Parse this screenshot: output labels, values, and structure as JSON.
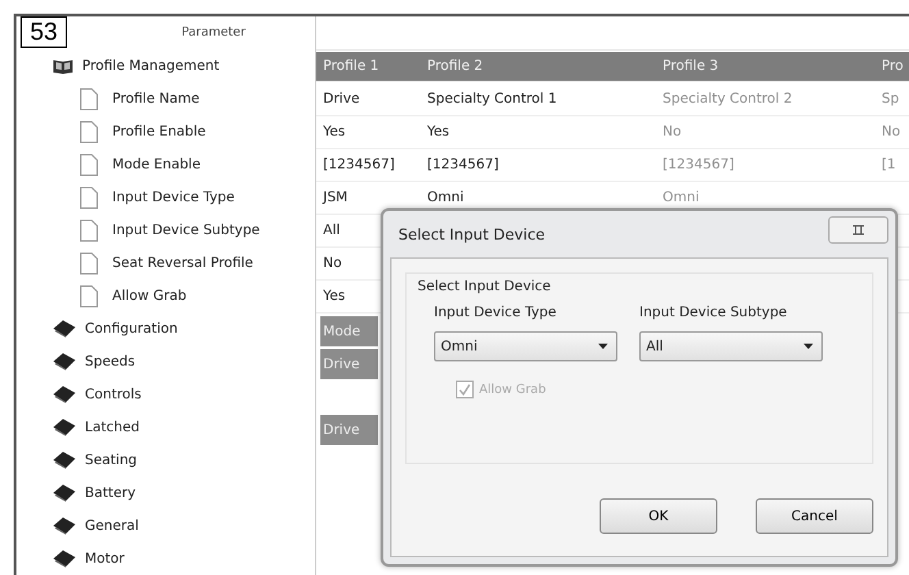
{
  "figure_label": "53",
  "tree": {
    "heading": "Parameter",
    "items": [
      {
        "label": "Profile Management",
        "expanded": true,
        "children": [
          {
            "label": "Profile Name"
          },
          {
            "label": "Profile Enable"
          },
          {
            "label": "Mode Enable"
          },
          {
            "label": "Input Device Type"
          },
          {
            "label": "Input Device Subtype"
          },
          {
            "label": "Seat Reversal Profile"
          },
          {
            "label": "Allow Grab"
          }
        ]
      },
      {
        "label": "Configuration",
        "expanded": false
      },
      {
        "label": "Speeds",
        "expanded": false
      },
      {
        "label": "Controls",
        "expanded": false
      },
      {
        "label": "Latched",
        "expanded": false
      },
      {
        "label": "Seating",
        "expanded": false
      },
      {
        "label": "Battery",
        "expanded": false
      },
      {
        "label": "General",
        "expanded": false
      },
      {
        "label": "Motor",
        "expanded": false
      }
    ]
  },
  "grid": {
    "columns": [
      {
        "header": "Profile 1",
        "dimmed": false
      },
      {
        "header": "Profile 2",
        "dimmed": false
      },
      {
        "header": "Profile 3",
        "dimmed": true
      },
      {
        "header": "Pro",
        "dimmed": true
      }
    ],
    "rows": [
      {
        "kind": "value",
        "cells": [
          "Drive",
          "Specialty Control 1",
          "Specialty Control 2",
          "Sp"
        ]
      },
      {
        "kind": "value",
        "cells": [
          "Yes",
          "Yes",
          "No",
          "No"
        ]
      },
      {
        "kind": "value",
        "cells": [
          "[1234567]",
          "[1234567]",
          "[1234567]",
          "[1"
        ]
      },
      {
        "kind": "value",
        "cells": [
          "JSM",
          "Omni",
          "Omni"
        ]
      },
      {
        "kind": "value",
        "cells": [
          "All"
        ]
      },
      {
        "kind": "value",
        "cells": [
          "No"
        ]
      },
      {
        "kind": "value",
        "cells": [
          "Yes"
        ]
      },
      {
        "kind": "section",
        "cells": [
          "Mode"
        ]
      },
      {
        "kind": "section",
        "cells": [
          "Drive"
        ]
      },
      {
        "kind": "blank",
        "cells": []
      },
      {
        "kind": "section",
        "cells": [
          "Drive"
        ]
      }
    ]
  },
  "dialog": {
    "title": "Select Input Device",
    "group_title": "Select Input Device",
    "fields": [
      {
        "label": "Input Device Type",
        "value": "Omni"
      },
      {
        "label": "Input Device Subtype",
        "value": "All"
      }
    ],
    "checkbox": {
      "label": "Allow Grab",
      "checked": true,
      "disabled": true
    },
    "buttons": [
      "OK",
      "Cancel"
    ]
  }
}
